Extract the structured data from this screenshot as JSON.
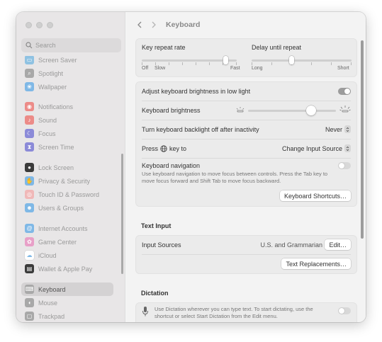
{
  "window": {
    "title": "Keyboard"
  },
  "sidebar": {
    "search_placeholder": "Search",
    "items": [
      {
        "label": "Screen Saver",
        "icon": "screen-saver-icon",
        "color": "#8fc2e2"
      },
      {
        "label": "Spotlight",
        "icon": "spotlight-icon",
        "color": "#a8a8a8"
      },
      {
        "label": "Wallpaper",
        "icon": "wallpaper-icon",
        "color": "#7fb8e6"
      },
      {
        "label": "Notifications",
        "icon": "notifications-icon",
        "color": "#ec8b88"
      },
      {
        "label": "Sound",
        "icon": "sound-icon",
        "color": "#ec8b88"
      },
      {
        "label": "Focus",
        "icon": "focus-icon",
        "color": "#8b8ad8"
      },
      {
        "label": "Screen Time",
        "icon": "screen-time-icon",
        "color": "#8b8ad8"
      },
      {
        "label": "Lock Screen",
        "icon": "lock-icon",
        "color": "#3b3b3b"
      },
      {
        "label": "Privacy & Security",
        "icon": "privacy-hand-icon",
        "color": "#7fb8e6"
      },
      {
        "label": "Touch ID & Password",
        "icon": "fingerprint-icon",
        "color": "#f0b8b8"
      },
      {
        "label": "Users & Groups",
        "icon": "users-icon",
        "color": "#7fb8e6"
      },
      {
        "label": "Internet Accounts",
        "icon": "at-sign-icon",
        "color": "#7fb8e6"
      },
      {
        "label": "Game Center",
        "icon": "game-center-icon",
        "color": "#e8a0c8"
      },
      {
        "label": "iCloud",
        "icon": "cloud-icon",
        "color": "#ffffff"
      },
      {
        "label": "Wallet & Apple Pay",
        "icon": "wallet-icon",
        "color": "#3b3b3b"
      },
      {
        "label": "Keyboard",
        "icon": "keyboard-icon",
        "color": "#a8a8a8",
        "selected": true
      },
      {
        "label": "Mouse",
        "icon": "mouse-icon",
        "color": "#a8a8a8"
      },
      {
        "label": "Trackpad",
        "icon": "trackpad-icon",
        "color": "#a8a8a8"
      }
    ]
  },
  "toolbar": {
    "title": "Keyboard"
  },
  "key_repeat": {
    "label": "Key repeat rate",
    "left_label": "Off",
    "slow_label": "Slow",
    "fast_label": "Fast",
    "value_fraction": 0.88
  },
  "delay_repeat": {
    "label": "Delay until repeat",
    "long_label": "Long",
    "short_label": "Short",
    "value_fraction": 0.4
  },
  "settings": {
    "adjust_brightness": {
      "label": "Adjust keyboard brightness in low light",
      "on": true
    },
    "keyboard_brightness": {
      "label": "Keyboard brightness",
      "value_fraction": 0.72
    },
    "backlight_off": {
      "label": "Turn keyboard backlight off after inactivity",
      "value": "Never"
    },
    "press_key": {
      "label_before": "Press",
      "label_after": "key to",
      "value": "Change Input Source"
    },
    "keyboard_navigation": {
      "label": "Keyboard navigation",
      "description": "Use keyboard navigation to move focus between controls. Press the Tab key to move focus forward and Shift Tab to move focus backward.",
      "on": false
    },
    "shortcuts_button": "Keyboard Shortcuts…"
  },
  "text_input": {
    "section_title": "Text Input",
    "input_sources_label": "Input Sources",
    "input_sources_value": "U.S. and Grammarian",
    "edit_button": "Edit…",
    "replacements_button": "Text Replacements…"
  },
  "dictation": {
    "section_title": "Dictation",
    "description": "Use Dictation wherever you can type text. To start dictating, use the shortcut or select Start Dictation from the Edit menu.",
    "on": false
  }
}
